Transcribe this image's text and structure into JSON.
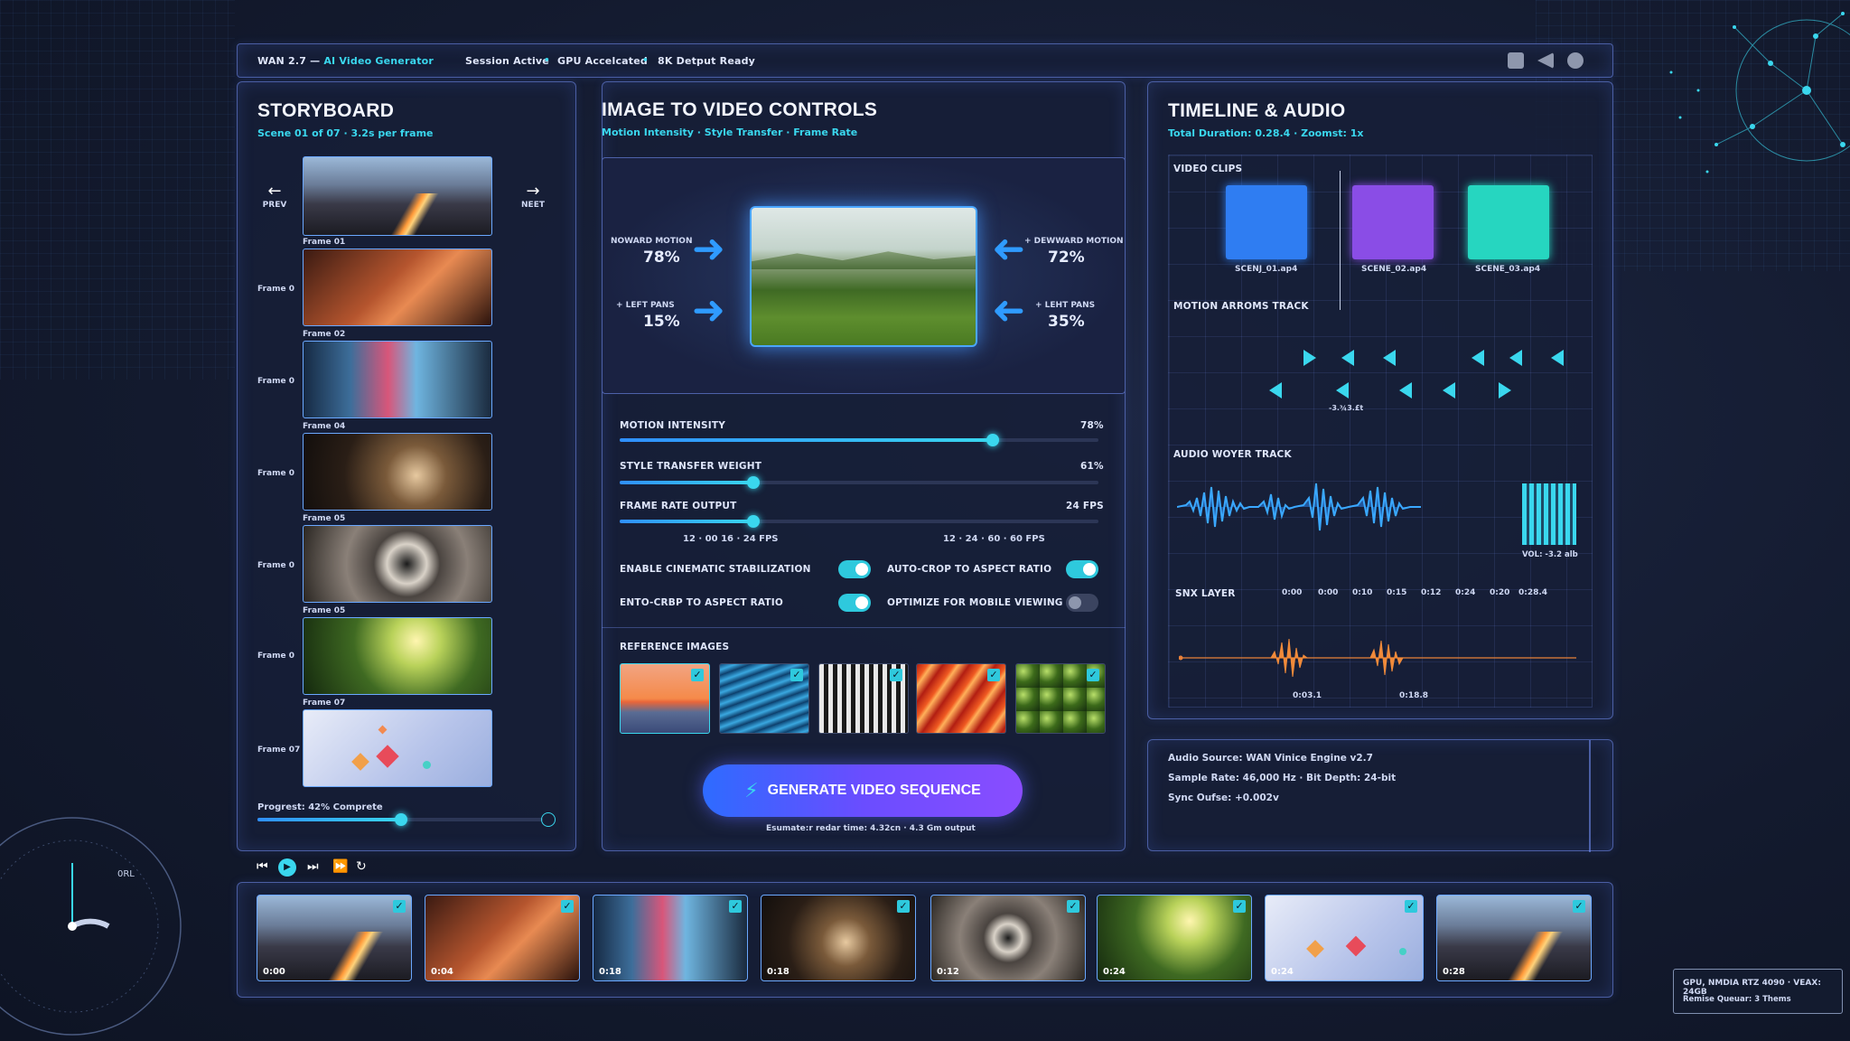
{
  "topbar": {
    "app": "WAN 2.7",
    "sep": "—",
    "subtitle": "AI Video Generator",
    "status1": "Session Active",
    "status2": "GPU Accelcated",
    "status3": "8K Detput Ready",
    "dot": "•"
  },
  "storyboard": {
    "title": "STORYBOARD",
    "subtitle": "Scene 01 of 07 · 3.2s per frame",
    "prev": "PREV",
    "next": "NEET",
    "frames": [
      {
        "caption": "Frame 01",
        "side": ""
      },
      {
        "caption": "Frame 02",
        "side": "Frame 0"
      },
      {
        "caption": "Frame 04",
        "side": "Frame 0"
      },
      {
        "caption": "Frame 05",
        "side": "Frame 0"
      },
      {
        "caption": "Frame 05",
        "side": "Frame 0"
      },
      {
        "caption": "Frame 07",
        "side": "Frame 0"
      },
      {
        "caption": "",
        "side": "Frame 07"
      }
    ],
    "progress_label": "Progrest: 42% Comprete",
    "progress": 0.42
  },
  "controls": {
    "title": "IMAGE TO VIDEO CONTROLS",
    "subtitle": "Motion Intensity  ·  Style Transfer  ·  Frame Rate",
    "motion_left": [
      {
        "label": "NOWARD MOTION",
        "value": "78%"
      },
      {
        "label": "+ LEFT PANS",
        "value": "15%"
      }
    ],
    "motion_right": [
      {
        "label": "+ DEWWARD MOTION",
        "value": "72%"
      },
      {
        "label": "+ LEHT PANS",
        "value": "35%"
      }
    ],
    "sliders": [
      {
        "label": "MOTION INTENSITY",
        "value": "78%",
        "level": 0.78
      },
      {
        "label": "STYLE TRANSFER WEIGHT",
        "value": "61%",
        "level": 0.28
      },
      {
        "label": "FRAME RATE OUTPUT",
        "value": "24 FPS",
        "level": 0.28
      }
    ],
    "fps_left": "12 · 00 16 · 24 FPS",
    "fps_right": "12 · 24 · 60 · 60 FPS",
    "toggles": [
      {
        "label": "ENABLE CINEMATIC STABILIZATION",
        "on": true
      },
      {
        "label": "AUTO-CROP TO ASPECT RATIO",
        "on": true
      },
      {
        "label": "ENTO-CRBP TO ASPECT RATIO",
        "on": true
      },
      {
        "label": "OPTIMIZE FOR MOBILE VIEWING",
        "on": false
      }
    ],
    "ref_title": "REFERENCE IMAGES",
    "generate_label": "GENERATE VIDEO SEQUENCE",
    "estimate": "Esumate:r redar time: 4.32cn  ·  4.3 Gm output"
  },
  "timeline": {
    "title": "TIMELINE & AUDIO",
    "subtitle": "Total Duration: 0.28.4  ·  Zoomst: 1x",
    "video_clips_label": "VIDEO CLIPS",
    "clips": [
      {
        "name": "SCENJ_01.ap4",
        "color": "#2f7df2"
      },
      {
        "name": "SCENE_02.ap4",
        "color": "#8a4de6"
      },
      {
        "name": "SCENE_03.ap4",
        "color": "#26d6c0"
      }
    ],
    "motion_track_label": "MOTION ARROMS TRACK",
    "motion_marker": "-3.¾3.£t",
    "audio_track_label": "AUDIO WOYER TRACK",
    "vol": "VOL: -3.2 alb",
    "sfx_label": "SNX LAYER",
    "ticks": [
      "0:00",
      "0:00",
      "0:10",
      "0:15",
      "0:12",
      "0:24",
      "0:20",
      "0:28.4"
    ],
    "sfx_markers": [
      "0:03.1",
      "0:18.8"
    ]
  },
  "audioinfo": {
    "line1": "Audio Source: WAN Vinice Engine v2.7",
    "line2": "Sample Rate: 46,000 Hz  ·  Bit Depth: 24-bit",
    "line3": "Sync Oufse: +0.002v"
  },
  "filmstrip": {
    "times": [
      "0:00",
      "0:04",
      "0:18",
      "0:18",
      "0:12",
      "0:24",
      "0:24",
      "0:28"
    ]
  },
  "gauge": {
    "label": "0RL"
  },
  "gpu": {
    "line1": "GPU, NMDIA RTZ 4090  ·  VEAX: 24GB",
    "line2": "Remise Queuar: 3 Thems"
  },
  "colors": {
    "accent": "#3ad7ee",
    "accent2": "#2f8fff",
    "panel_border": "#7896ff",
    "generate_start": "#2e6bff",
    "generate_end": "#8a4dff"
  }
}
